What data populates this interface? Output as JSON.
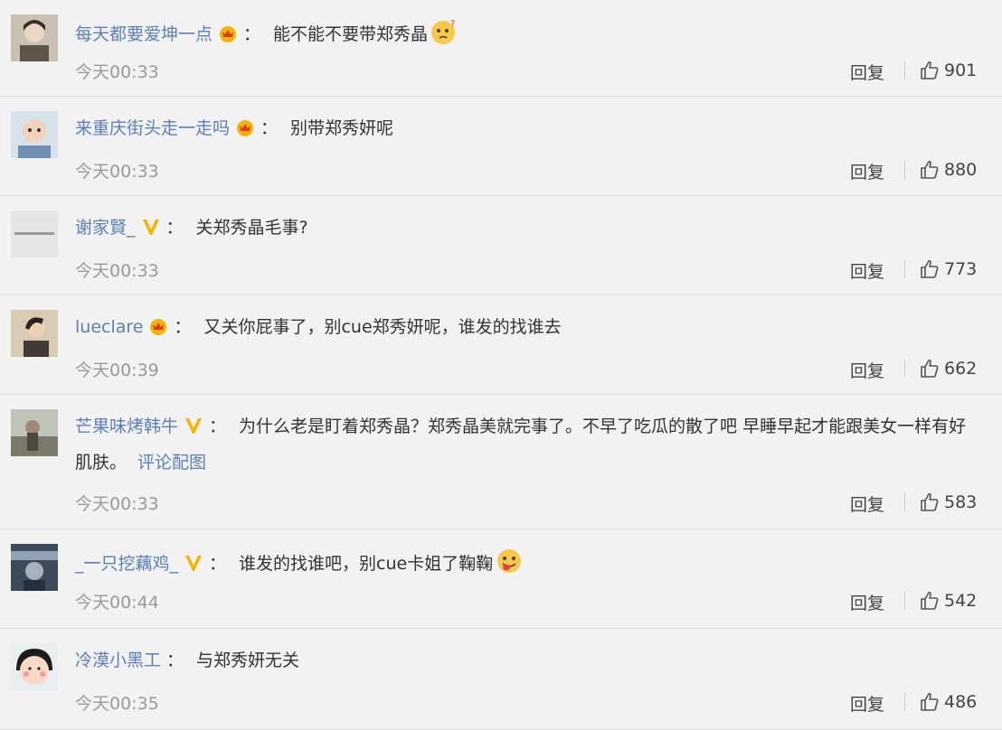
{
  "colors": {
    "username": "#5b7fb6",
    "text": "#333333",
    "time": "#9a9a9a",
    "crown": "#f5b400",
    "vip_v": "#f5b400"
  },
  "labels": {
    "reply": "回复",
    "like_icon": "thumbs-up-icon"
  },
  "comments": [
    {
      "username": "每天都要爱坤一点",
      "badge": "crown-badge",
      "separator": "：",
      "content": "能不能不要带郑秀晶",
      "emoji": "thinking-emoji",
      "time": "今天00:33",
      "likes": "901"
    },
    {
      "username": "来重庆街头走一走吗",
      "badge": "crown-badge",
      "separator": "：",
      "content": "别带郑秀妍呢",
      "time": "今天00:33",
      "likes": "880"
    },
    {
      "username": "谢家賢_",
      "badge": "vip-v-badge",
      "separator": "：",
      "content": "关郑秀晶毛事?",
      "time": "今天00:33",
      "likes": "773"
    },
    {
      "username": "lueclare",
      "badge": "crown-badge",
      "separator": "：",
      "content": "又关你屁事了，别cue郑秀妍呢，谁发的找谁去",
      "time": "今天00:39",
      "likes": "662"
    },
    {
      "username": "芒果味烤韩牛",
      "badge": "vip-v-badge",
      "separator": "：",
      "content": "为什么老是盯着郑秀晶？郑秀晶美就完事了。不早了吃瓜的散了吧 早睡早起才能跟美女一样有好肌肤。",
      "link": "评论配图",
      "time": "今天00:33",
      "likes": "583"
    },
    {
      "username": "_一只挖藕鸡_",
      "badge": "vip-v-badge",
      "separator": "：",
      "content": "谁发的找谁吧，别cue卡姐了鞠鞠",
      "emoji": "tongue-emoji",
      "time": "今天00:44",
      "likes": "542"
    },
    {
      "username": "冷漠小黑工",
      "separator": "：",
      "content": "与郑秀妍无关",
      "time": "今天00:35",
      "likes": "486"
    }
  ]
}
